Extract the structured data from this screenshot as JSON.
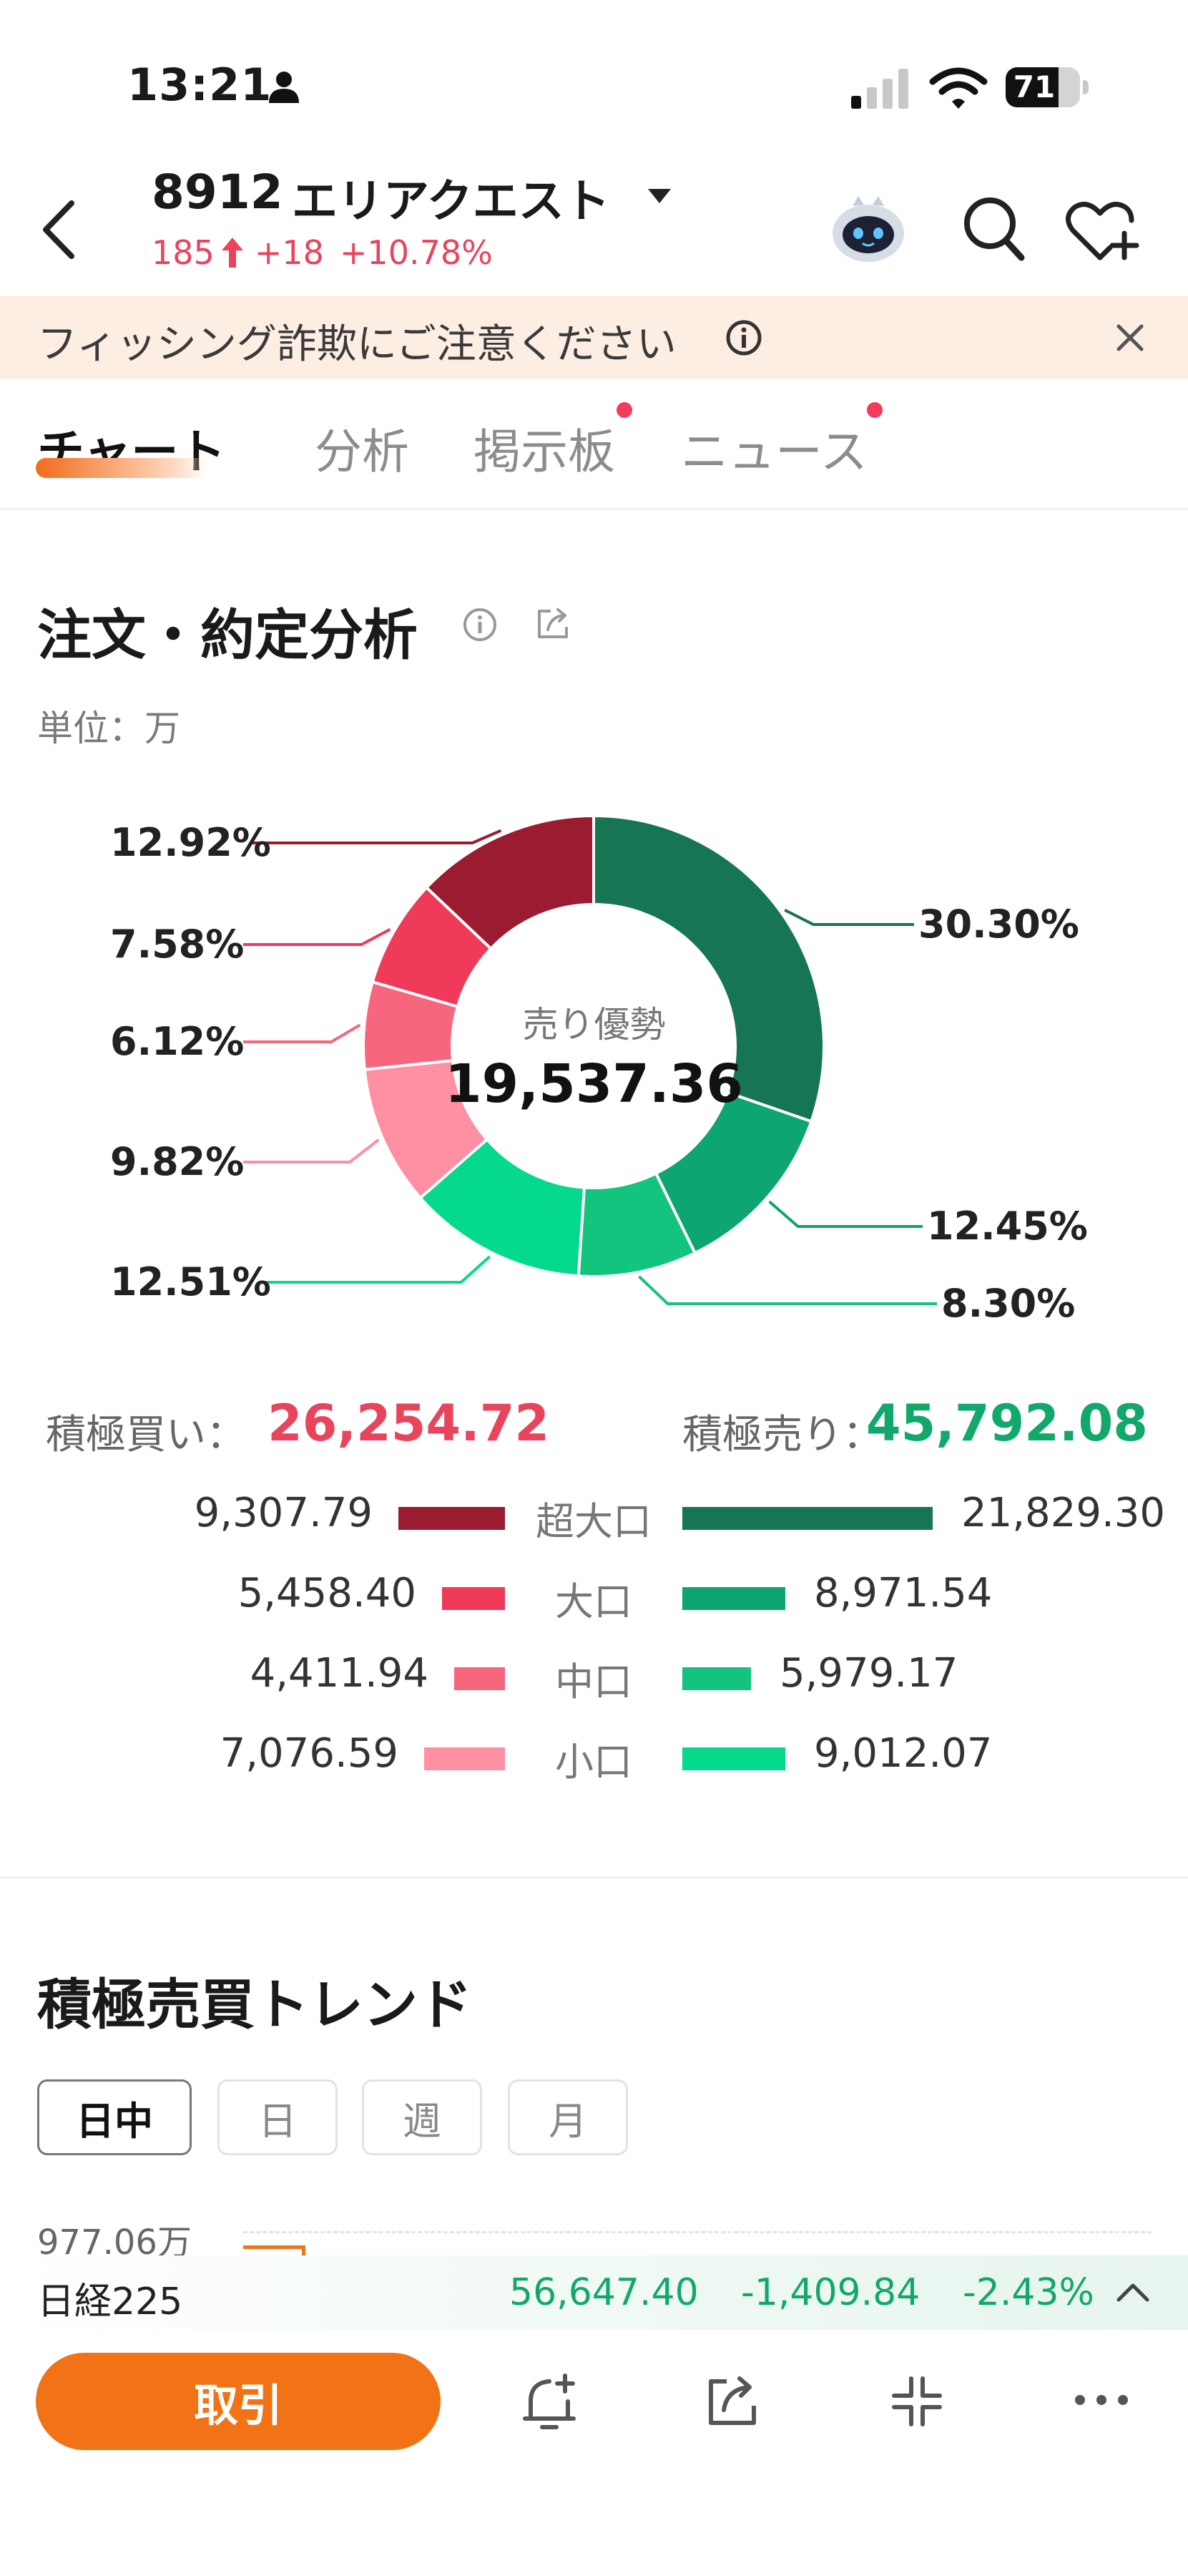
{
  "status_bar": {
    "time": "13:21",
    "battery": "71"
  },
  "header": {
    "code": "8912",
    "name": "エリアクエスト",
    "price": "185",
    "change": "+18",
    "change_pct": "+10.78%"
  },
  "banner": {
    "text": "フィッシング詐欺にご注意ください"
  },
  "tabs": [
    {
      "label": "チャート"
    },
    {
      "label": "分析"
    },
    {
      "label": "掲示板"
    },
    {
      "label": "ニュース"
    }
  ],
  "section": {
    "title": "注文・約定分析",
    "unit": "単位：万"
  },
  "donut": {
    "center_label": "売り優勢",
    "center_value": "19,537.36"
  },
  "chart_data": {
    "type": "pie",
    "slices": [
      {
        "label": "30.30%",
        "value": 30.3,
        "color": "#167553"
      },
      {
        "label": "12.45%",
        "value": 12.45,
        "color": "#0da570"
      },
      {
        "label": "8.30%",
        "value": 8.3,
        "color": "#13c47e"
      },
      {
        "label": "12.51%",
        "value": 12.51,
        "color": "#05d98c"
      },
      {
        "label": "9.82%",
        "value": 9.82,
        "color": "#ff8fa3"
      },
      {
        "label": "6.12%",
        "value": 6.12,
        "color": "#f6677e"
      },
      {
        "label": "7.58%",
        "value": 7.58,
        "color": "#ef3b59"
      },
      {
        "label": "12.92%",
        "value": 12.92,
        "color": "#9b1b30"
      }
    ]
  },
  "totals": {
    "buy_label": "積極買い：",
    "buy_value": "26,254.72",
    "sell_label": "積極売り：",
    "sell_value": "45,792.08",
    "buy_color": "#e8455d",
    "sell_color": "#12a86c"
  },
  "breakdown": [
    {
      "label": "超大口",
      "buy": "9,307.79",
      "sell": "21,829.30",
      "buy_value": 9307.79,
      "sell_value": 21829.3,
      "buy_color": "#9b1b30",
      "sell_color": "#167553"
    },
    {
      "label": "大口",
      "buy": "5,458.40",
      "sell": "8,971.54",
      "buy_value": 5458.4,
      "sell_value": 8971.54,
      "buy_color": "#ef3b59",
      "sell_color": "#0da570"
    },
    {
      "label": "中口",
      "buy": "4,411.94",
      "sell": "5,979.17",
      "buy_value": 4411.94,
      "sell_value": 5979.17,
      "buy_color": "#f6677e",
      "sell_color": "#13c47e"
    },
    {
      "label": "小口",
      "buy": "7,076.59",
      "sell": "9,012.07",
      "buy_value": 7076.59,
      "sell_value": 9012.07,
      "buy_color": "#ff8fa3",
      "sell_color": "#05d98c"
    }
  ],
  "trend": {
    "title": "積極売買トレンド",
    "periods": [
      {
        "label": "日中"
      },
      {
        "label": "日"
      },
      {
        "label": "週"
      },
      {
        "label": "月"
      }
    ],
    "axis_top": "977.06万"
  },
  "ticker": {
    "name": "日経225",
    "price": "56,647.40",
    "change": "-1,409.84",
    "change_pct": "-2.43%"
  },
  "bottom_bar": {
    "trade_label": "取引"
  }
}
